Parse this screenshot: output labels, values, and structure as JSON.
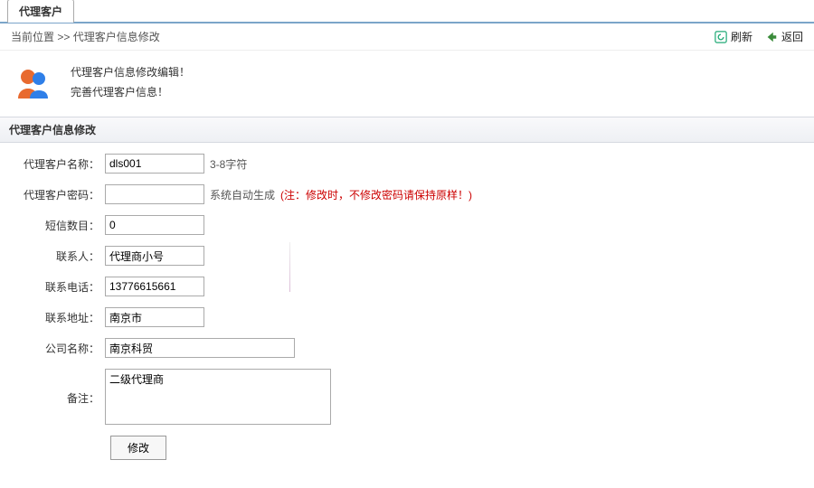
{
  "tab": {
    "label": "代理客户"
  },
  "breadcrumb": {
    "prefix": "当前位置 >> ",
    "current": "代理客户信息修改"
  },
  "actions": {
    "refresh": "刷新",
    "back": "返回"
  },
  "intro": {
    "line1": "代理客户信息修改编辑！",
    "line2": "完善代理客户信息！"
  },
  "section": {
    "title": "代理客户信息修改"
  },
  "form": {
    "fields": {
      "name": {
        "label": "代理客户名称：",
        "value": "dls001",
        "hint": "3-8字符"
      },
      "password": {
        "label": "代理客户密码：",
        "value": "",
        "hint_plain": "系统自动生成",
        "hint_red": "(注：修改时，不修改密码请保持原样！)"
      },
      "smsCount": {
        "label": "短信数目：",
        "value": "0"
      },
      "contact": {
        "label": "联系人：",
        "value": "代理商小号"
      },
      "phone": {
        "label": "联系电话：",
        "value": "13776615661"
      },
      "address": {
        "label": "联系地址：",
        "value": "南京市"
      },
      "company": {
        "label": "公司名称：",
        "value": "南京科贸"
      },
      "remark": {
        "label": "备注：",
        "value": "二级代理商"
      }
    },
    "submit": "修改"
  }
}
